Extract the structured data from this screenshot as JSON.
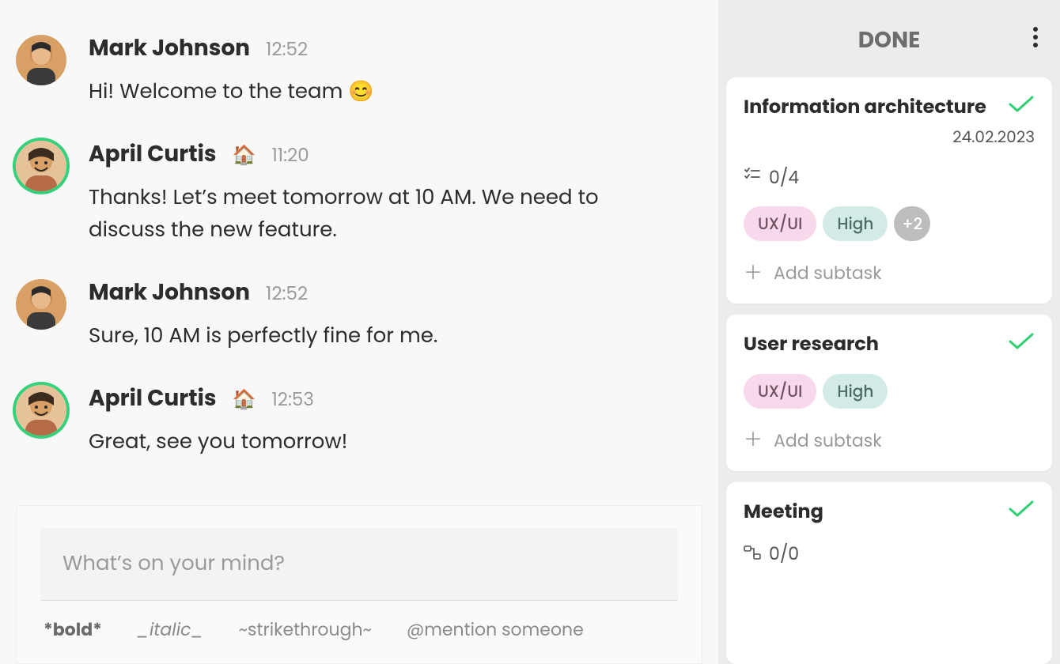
{
  "chat": {
    "messages": [
      {
        "author": "Mark Johnson",
        "time": "12:52",
        "online": false,
        "badge": "",
        "text": "Hi! Welcome to the team 😊"
      },
      {
        "author": "April Curtis",
        "time": "11:20",
        "online": true,
        "badge": "🏠",
        "text": "Thanks! Let’s meet tomorrow at 10 AM. We need to discuss the new feature."
      },
      {
        "author": "Mark Johnson",
        "time": "12:52",
        "online": false,
        "badge": "",
        "text": "Sure, 10 AM is perfectly fine for me."
      },
      {
        "author": "April Curtis",
        "time": "12:53",
        "online": true,
        "badge": "🏠",
        "text": "Great, see you tomorrow!"
      }
    ],
    "composer": {
      "placeholder": "What’s on your mind?",
      "hints": {
        "bold": "*bold*",
        "italic": "_italic_",
        "strike": "~strikethrough~",
        "mention": "@mention someone"
      }
    }
  },
  "tasks": {
    "title": "DONE",
    "addSubtaskLabel": "Add subtask",
    "cards": [
      {
        "title": "Information architecture",
        "date": "24.02.2023",
        "progress": "0/4",
        "tags": [
          "UX/UI",
          "High"
        ],
        "moreCount": "+2",
        "hasAdd": true
      },
      {
        "title": "User research",
        "date": "",
        "progress": "",
        "tags": [
          "UX/UI",
          "High"
        ],
        "moreCount": "",
        "hasAdd": true
      },
      {
        "title": "Meeting",
        "date": "",
        "progress": "0/0",
        "tags": [],
        "moreCount": "",
        "hasAdd": false
      }
    ]
  }
}
